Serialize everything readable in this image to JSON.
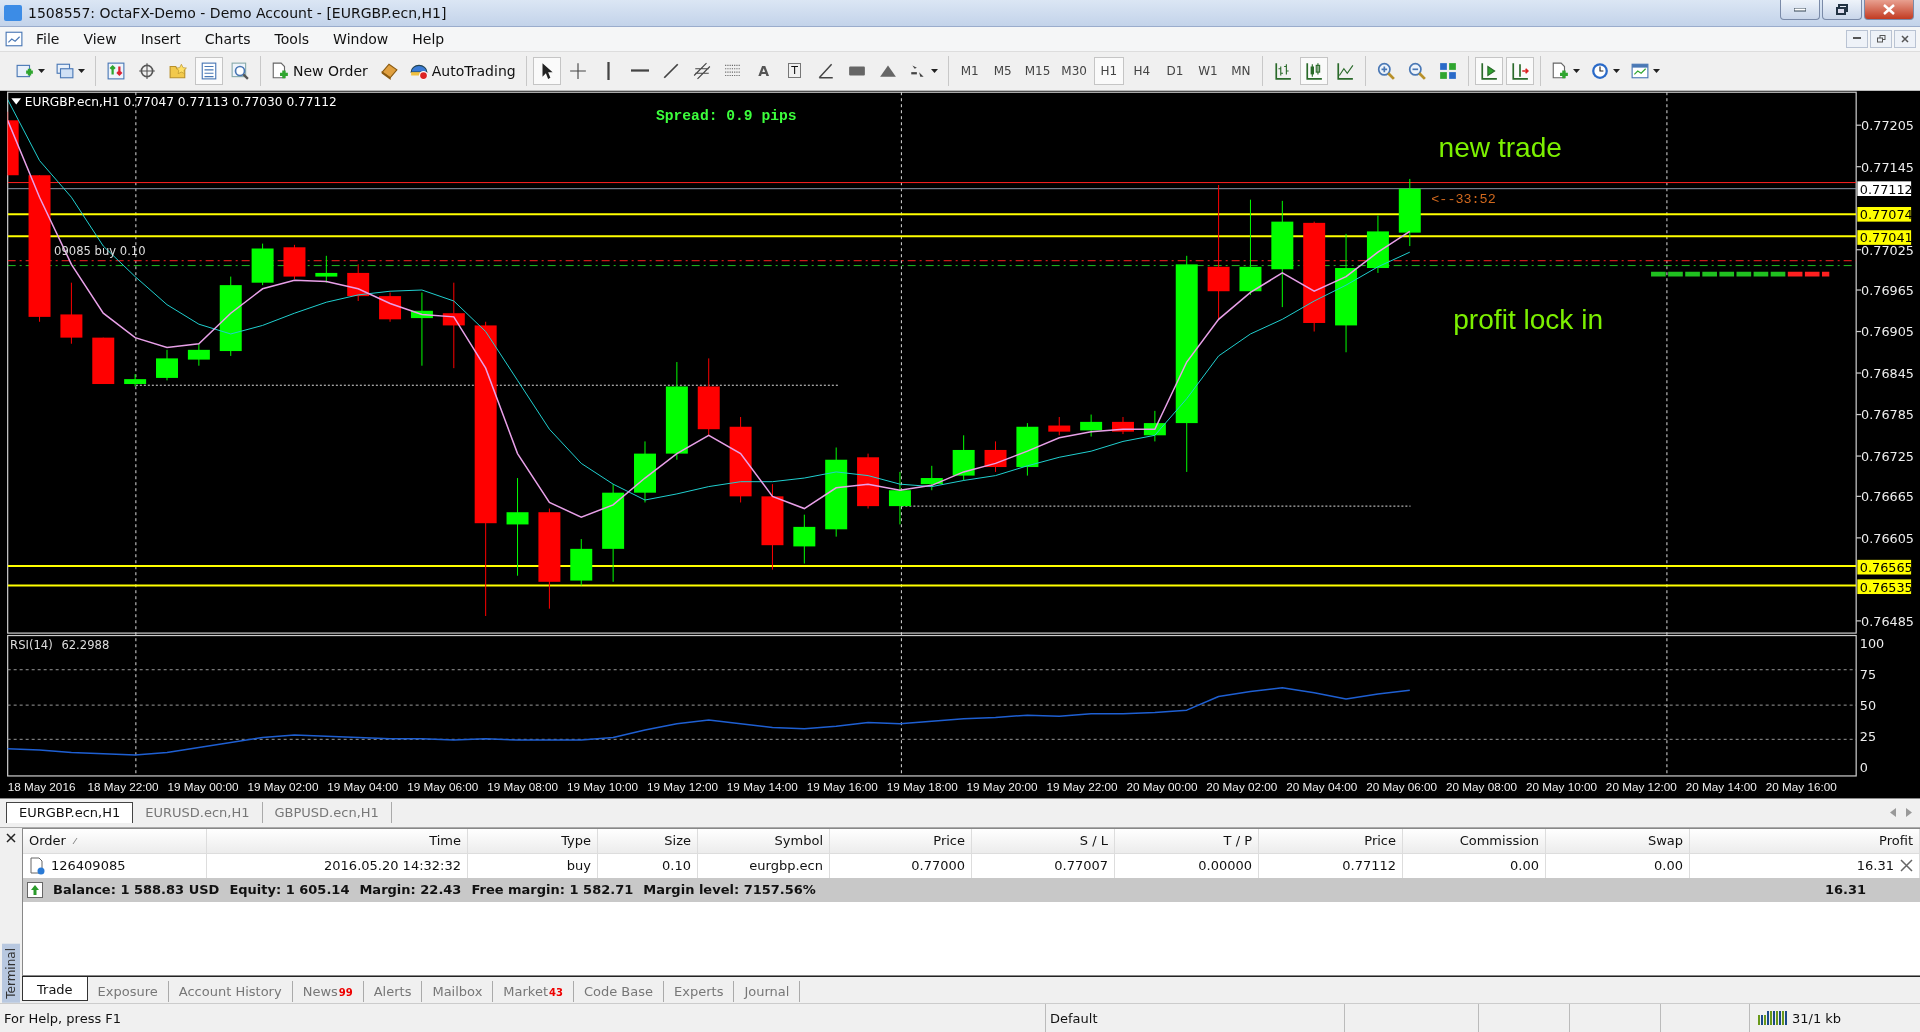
{
  "window": {
    "title": "1508557: OctaFX-Demo - Demo Account - [EURGBP.ecn,H1]"
  },
  "menu": [
    "File",
    "View",
    "Insert",
    "Charts",
    "Tools",
    "Window",
    "Help"
  ],
  "toolbar": [
    [
      {
        "kind": "new-chart",
        "pressed": false
      },
      {
        "kind": "profiles",
        "pressed": false
      }
    ],
    [
      {
        "kind": "market-watch",
        "pressed": false
      },
      {
        "kind": "navigator",
        "pressed": false
      },
      {
        "kind": "data-window",
        "pressed": false
      },
      {
        "kind": "terminal",
        "pressed": true
      },
      {
        "kind": "tester",
        "pressed": false
      }
    ],
    [
      {
        "kind": "new-order",
        "label": "New Order",
        "pressed": false
      },
      {
        "kind": "metaeditor",
        "pressed": false
      },
      {
        "kind": "autotrading",
        "label": "AutoTrading",
        "pressed": false
      }
    ],
    [
      {
        "kind": "cursor",
        "pressed": true
      },
      {
        "kind": "crosshair",
        "pressed": false
      },
      {
        "kind": "vline",
        "pressed": false
      },
      {
        "kind": "hline",
        "pressed": false
      },
      {
        "kind": "trendline",
        "pressed": false
      },
      {
        "kind": "channel",
        "pressed": false
      },
      {
        "kind": "gridlines",
        "pressed": false
      },
      {
        "kind": "text",
        "label": "A",
        "pressed": false
      },
      {
        "kind": "textlabel",
        "label": "T",
        "pressed": false
      },
      {
        "kind": "angleline",
        "pressed": false
      },
      {
        "kind": "rectangle",
        "pressed": false
      },
      {
        "kind": "triangle",
        "pressed": false
      },
      {
        "kind": "arrows",
        "pressed": false
      }
    ],
    [
      {
        "kind": "timeframe",
        "label": "M1",
        "pressed": false
      },
      {
        "kind": "timeframe",
        "label": "M5",
        "pressed": false
      },
      {
        "kind": "timeframe",
        "label": "M15",
        "pressed": false
      },
      {
        "kind": "timeframe",
        "label": "M30",
        "pressed": false
      },
      {
        "kind": "timeframe",
        "label": "H1",
        "pressed": true
      },
      {
        "kind": "timeframe",
        "label": "H4",
        "pressed": false
      },
      {
        "kind": "timeframe",
        "label": "D1",
        "pressed": false
      },
      {
        "kind": "timeframe",
        "label": "W1",
        "pressed": false
      },
      {
        "kind": "timeframe",
        "label": "MN",
        "pressed": false
      }
    ],
    [
      {
        "kind": "bar-chart",
        "pressed": false
      },
      {
        "kind": "candle-chart",
        "pressed": true
      },
      {
        "kind": "line-chart",
        "pressed": false
      }
    ],
    [
      {
        "kind": "zoom-in",
        "pressed": false
      },
      {
        "kind": "zoom-out",
        "pressed": false
      },
      {
        "kind": "tile",
        "pressed": false
      }
    ],
    [
      {
        "kind": "autoscroll",
        "pressed": true
      },
      {
        "kind": "chart-shift",
        "pressed": true
      }
    ],
    [
      {
        "kind": "indicators",
        "pressed": false
      },
      {
        "kind": "periods",
        "pressed": false
      },
      {
        "kind": "templates",
        "pressed": false
      }
    ]
  ],
  "chart": {
    "header": "EURGBP.ecn,H1 0.77047 0.77113 0.77030 0.77112",
    "spread": "Spread: 0.9 pips",
    "annotations": [
      "new trade",
      "profit lock in"
    ],
    "countdown": "<--33:52",
    "order_label": "09085 buy 0.10",
    "price_ticks": [
      "0.77205",
      "0.77145",
      "0.77025",
      "0.76965",
      "0.76905",
      "0.76845",
      "0.76785",
      "0.76725",
      "0.76665",
      "0.76605",
      "0.76485"
    ],
    "price_markers": [
      {
        "text": "0.77112",
        "kind": "bid"
      },
      {
        "text": "0.77074",
        "kind": "level"
      },
      {
        "text": "0.77041",
        "kind": "level"
      },
      {
        "text": "0.76565",
        "kind": "level"
      },
      {
        "text": "0.76535",
        "kind": "level"
      }
    ],
    "time_labels": [
      "18 May 2016",
      "18 May 22:00",
      "19 May 00:00",
      "19 May 02:00",
      "19 May 04:00",
      "19 May 06:00",
      "19 May 08:00",
      "19 May 10:00",
      "19 May 12:00",
      "19 May 14:00",
      "19 May 16:00",
      "19 May 18:00",
      "19 May 20:00",
      "19 May 22:00",
      "20 May 00:00",
      "20 May 02:00",
      "20 May 04:00",
      "20 May 06:00",
      "20 May 08:00",
      "20 May 10:00",
      "20 May 12:00",
      "20 May 14:00",
      "20 May 16:00"
    ],
    "rsi": {
      "name": "RSI(14)",
      "reading": "62.2988",
      "axis_labels": [
        "100",
        "75",
        "50",
        "25",
        "0"
      ]
    }
  },
  "chart_tabs": [
    {
      "label": "EURGBP.ecn,H1",
      "selected": true
    },
    {
      "label": "EURUSD.ecn,H1",
      "selected": false
    },
    {
      "label": "GBPUSD.ecn,H1",
      "selected": false
    }
  ],
  "terminal": {
    "side_label": "Terminal",
    "columns": [
      "Order",
      "Time",
      "Type",
      "Size",
      "Symbol",
      "Price",
      "S / L",
      "T / P",
      "Price",
      "Commission",
      "Swap",
      "Profit"
    ],
    "rows": [
      [
        "126409085",
        "2016.05.20 14:32:32",
        "buy",
        "0.10",
        "eurgbp.ecn",
        "0.77000",
        "0.77007",
        "0.00000",
        "0.77112",
        "0.00",
        "0.00",
        "16.31"
      ]
    ],
    "summary": [
      "Balance: 1 588.83 USD",
      "Equity: 1 605.14",
      "Margin: 22.43",
      "Free margin: 1 582.71",
      "Margin level: 7157.56%"
    ],
    "summary_profit": "16.31",
    "tabs": [
      {
        "label": "Trade",
        "selected": true
      },
      {
        "label": "Exposure",
        "selected": false
      },
      {
        "label": "Account History",
        "selected": false
      },
      {
        "label": "News",
        "badge": "99",
        "selected": false
      },
      {
        "label": "Alerts",
        "selected": false
      },
      {
        "label": "Mailbox",
        "selected": false
      },
      {
        "label": "Market",
        "badge": "43",
        "selected": false
      },
      {
        "label": "Code Base",
        "selected": false
      },
      {
        "label": "Experts",
        "selected": false
      },
      {
        "label": "Journal",
        "selected": false
      }
    ]
  },
  "status_bar": {
    "help": "For Help, press F1",
    "profile": "Default",
    "traffic": "31/1 kb"
  }
}
